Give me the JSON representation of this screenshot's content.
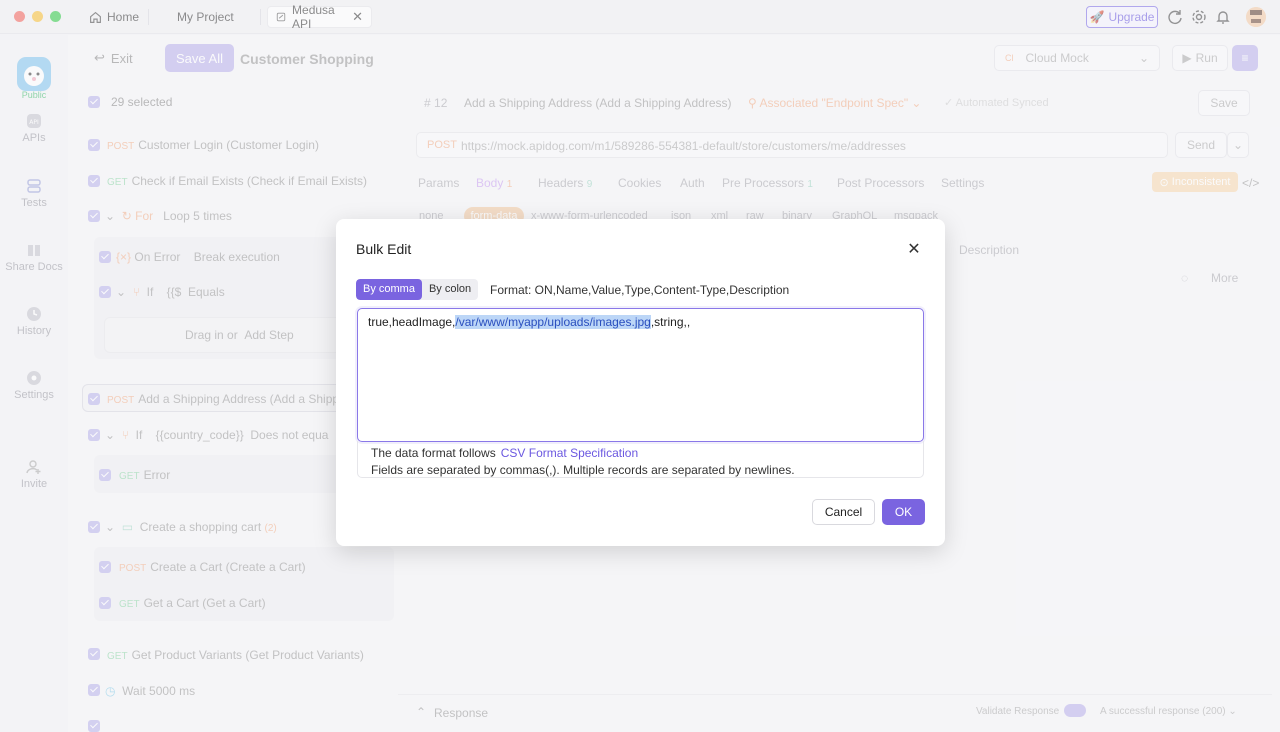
{
  "titlebar": {
    "tabs": [
      "Home",
      "My Project",
      "Medusa API"
    ],
    "upgrade_label": "Upgrade"
  },
  "rail": {
    "logo_label": "Public",
    "items": [
      "APIs",
      "Tests",
      "Share Docs",
      "History",
      "Settings",
      "Invite"
    ]
  },
  "sidebar": {
    "exit_label": "Exit",
    "save_all_label": "Save All",
    "collection_title": "Customer Shopping",
    "selected_count": "29 selected",
    "rows": [
      {
        "method": "POST",
        "label": "Customer Login (Customer Login)"
      },
      {
        "method": "GET",
        "label": "Check if Email Exists (Check if Email Exists)"
      },
      {
        "keyword": "For",
        "label": "Loop 5 times"
      },
      {
        "keyword": "On Error",
        "label": "Break execution"
      },
      {
        "keyword": "If",
        "label": "{{$",
        "op": "Equals"
      },
      {
        "label": "Drag in or",
        "action": "Add Step"
      },
      {
        "method": "POST",
        "label": "Add a Shipping Address (Add a Shippi"
      },
      {
        "keyword": "If",
        "label": "{{country_code}}",
        "op": "Does not equa"
      },
      {
        "method": "GET",
        "label": "Error"
      },
      {
        "label": "Create a shopping cart",
        "count": "(2)"
      },
      {
        "method": "POST",
        "label": "Create a Cart (Create a Cart)"
      },
      {
        "method": "GET",
        "label": "Get a Cart (Get a Cart)"
      },
      {
        "method": "GET",
        "label": "Get Product Variants (Get Product Variants)"
      },
      {
        "label": "Wait 5000 ms"
      }
    ]
  },
  "main": {
    "env_label": "Cloud Mock",
    "run_label": "Run",
    "step_no": "12",
    "step_title": "Add a Shipping Address (Add a Shipping Address)",
    "associated": "Associated \"Endpoint Spec\"",
    "synced": "Automated Synced",
    "save_label": "Save",
    "method": "POST",
    "url": "https://mock.apidog.com/m1/589286-554381-default/store/customers/me/addresses",
    "send_label": "Send",
    "tabs": [
      "Params",
      "Body",
      "Headers",
      "Cookies",
      "Auth",
      "Pre Processors",
      "Post Processors",
      "Settings"
    ],
    "body_count": "1",
    "headers_count": "9",
    "pre_count": "1",
    "inconsistent": "Inconsistent",
    "body_types": [
      "none",
      "form-data",
      "x-www-form-urlencoded",
      "json",
      "xml",
      "raw",
      "binary",
      "GraphQL",
      "msgpack"
    ],
    "description_header": "Description",
    "more_label": "More",
    "response_label": "Response",
    "validate_label": "Validate Response",
    "success_label": "A successful response (200)"
  },
  "modal": {
    "title": "Bulk Edit",
    "by_comma": "By comma",
    "by_colon": "By colon",
    "format": "Format: ON,Name,Value,Type,Content-Type,Description",
    "content_prefix": "true,headImage,",
    "content_highlight": "/var/www/myapp/uploads/images.jpg",
    "content_suffix": ",string,,",
    "hint_line1": "The data format follows",
    "hint_link": "CSV Format Specification",
    "hint_line2": "Fields are separated by commas(,). Multiple records are separated by newlines.",
    "cancel_label": "Cancel",
    "ok_label": "OK"
  }
}
